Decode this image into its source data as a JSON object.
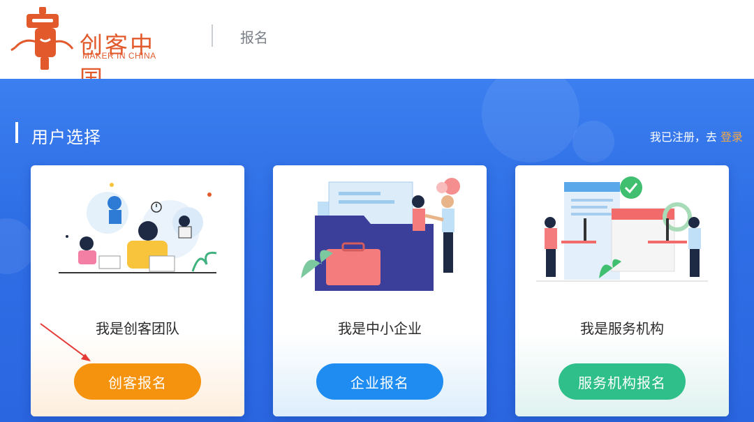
{
  "header": {
    "logo_cn": "创客中国",
    "logo_en": "MAKER IN CHINA",
    "page_title": "报名"
  },
  "section": {
    "title": "用户选择",
    "login_prefix": "我已注册，去",
    "login_link": "登录"
  },
  "cards": [
    {
      "label": "我是创客团队",
      "button": "创客报名",
      "button_color": "#f5930f"
    },
    {
      "label": "我是中小企业",
      "button": "企业报名",
      "button_color": "#1e8cf0"
    },
    {
      "label": "我是服务机构",
      "button": "服务机构报名",
      "button_color": "#2fbf8a"
    }
  ],
  "colors": {
    "brand": "#e25a2c",
    "main_bg": "#2f6fe6",
    "link_accent": "#f3a84a"
  }
}
